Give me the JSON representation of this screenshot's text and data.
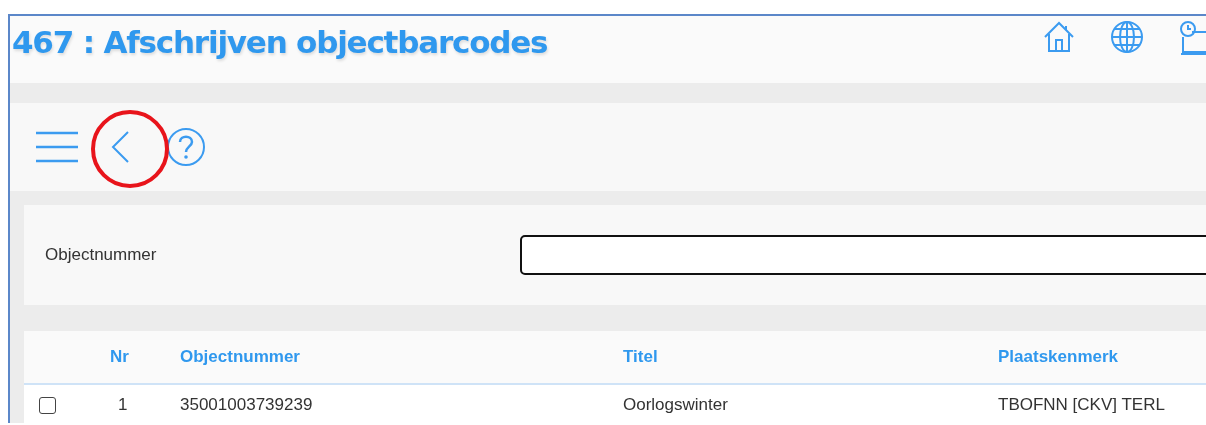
{
  "window": {
    "title": "467 : Afschrijven objectbarcodes"
  },
  "form": {
    "fields": [
      {
        "label": "Objectnummer"
      }
    ]
  },
  "table": {
    "columns": [
      "Nr",
      "Objectnummer",
      "Titel",
      "Plaatskenmerk"
    ],
    "rows": [
      {
        "checked": false,
        "cells": [
          "1",
          "35001003739239",
          "Oorlogswinter",
          "TBOFNN [CKV] TERL"
        ]
      }
    ]
  }
}
